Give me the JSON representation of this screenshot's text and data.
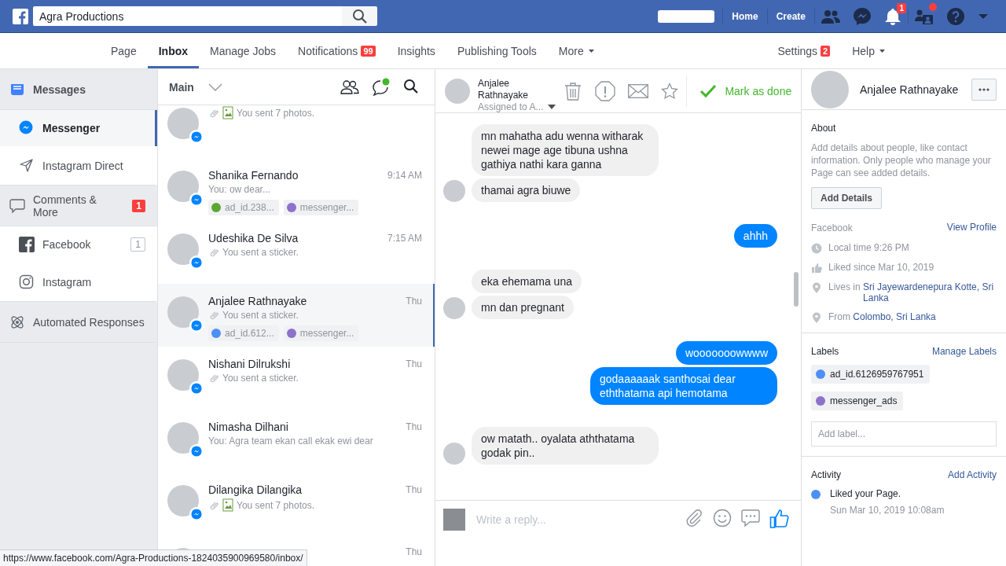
{
  "topbar": {
    "search": {
      "value": "Agra Productions"
    },
    "links": [
      "Home",
      "Create"
    ],
    "notification_badge": "1"
  },
  "tabs": [
    {
      "label": "Page",
      "selected": false,
      "dropdown": false
    },
    {
      "label": "Inbox",
      "selected": true,
      "dropdown": false
    },
    {
      "label": "Manage Jobs",
      "selected": false,
      "dropdown": false
    },
    {
      "label": "Notifications",
      "selected": false,
      "dropdown": false,
      "badge": "99"
    },
    {
      "label": "Insights",
      "selected": false,
      "dropdown": false
    },
    {
      "label": "Publishing Tools",
      "selected": false,
      "dropdown": false
    },
    {
      "label": "More",
      "selected": false,
      "dropdown": true
    }
  ],
  "tabs_right": [
    {
      "label": "Settings",
      "dropdown": false,
      "badge": "2"
    },
    {
      "label": "Help",
      "dropdown": true
    }
  ],
  "sidebar": {
    "items": [
      {
        "kind": "section",
        "label": "Messages",
        "selected": false
      },
      {
        "kind": "sub",
        "label": "Messenger",
        "selected": true
      },
      {
        "kind": "sub",
        "label": "Instagram Direct",
        "selected": false
      },
      {
        "kind": "section",
        "label": "Comments & More",
        "selected": false,
        "badge": "1"
      },
      {
        "kind": "sub",
        "label": "Facebook",
        "selected": false,
        "count": "1"
      },
      {
        "kind": "sub",
        "label": "Instagram",
        "selected": false
      },
      {
        "kind": "section",
        "label": "Automated Responses",
        "selected": false
      }
    ]
  },
  "conversation_list": {
    "filter": "Main",
    "conversations": [
      {
        "kind": "photos",
        "preview": "You sent 7 photos.",
        "selected": false
      },
      {
        "kind": "text",
        "name": "Shanika Fernando",
        "time": "9:14 AM",
        "preview": "You: ow dear...",
        "selected": false,
        "labels": [
          {
            "text": "ad_id.238...",
            "color": "#5aa82f"
          },
          {
            "text": "messenger...",
            "color": "#8c72cb"
          }
        ]
      },
      {
        "kind": "sticker",
        "name": "Udeshika De Silva",
        "time": "7:15 AM",
        "preview": "You sent a sticker.",
        "selected": false
      },
      {
        "kind": "sticker",
        "name": "Anjalee Rathnayake",
        "time": "Thu",
        "preview": "You sent a sticker.",
        "selected": true,
        "labels": [
          {
            "text": "ad_id.612...",
            "color": "#4e8ff5"
          },
          {
            "text": "messenger...",
            "color": "#8c72cb"
          }
        ]
      },
      {
        "kind": "sticker",
        "name": "Nishani Dilrukshi",
        "time": "Thu",
        "preview": "You sent a sticker.",
        "selected": false
      },
      {
        "kind": "text",
        "name": "Nimasha Dilhani",
        "time": "Thu",
        "preview": "You: Agra team ekan call ekak ewi dear",
        "selected": false
      },
      {
        "kind": "photos",
        "name": "Dilangika Dilangika",
        "time": "Thu",
        "preview": "You sent 7 photos.",
        "selected": false
      },
      {
        "time": "Thu",
        "selected": false
      }
    ]
  },
  "chat": {
    "name": "Anjalee Rathnayake",
    "assigned": "Assigned to A...",
    "done": "Mark as done",
    "groups": [
      {
        "kind": "received",
        "bubbles": [
          "mn mahatha adu wenna witharak newei mage age tibuna ushna gathiya nathi kara ganna",
          "thamai agra biuwe"
        ]
      },
      {
        "kind": "sent",
        "bubbles": [
          "ahhh"
        ]
      },
      {
        "kind": "received",
        "bubbles": [
          "eka ehemama una",
          "mn dan pregnant"
        ]
      },
      {
        "kind": "sent",
        "bubbles": [
          "wooooooowwww",
          "godaaaaaak santhosai dear eththatama api hemotama"
        ]
      },
      {
        "kind": "received",
        "bubbles": [
          "ow matath.. oyalata aththatama godak pin.."
        ]
      }
    ],
    "composer": {
      "placeholder": "Write a reply..."
    }
  },
  "details": {
    "name": "Anjalee Rathnayake",
    "about": {
      "title": "About",
      "text": "Add details about people, like contact information. Only people who manage your Page can see added details.",
      "button": "Add Details"
    },
    "facebook": {
      "title": "Facebook",
      "link": "View Profile",
      "rows": [
        {
          "text": "Local time 9:26 PM"
        },
        {
          "text": "Liked since Mar 10, 2019"
        },
        {
          "text": "Lives in ",
          "link": "Sri Jayewardenepura Kotte, Sri Lanka"
        },
        {
          "text": "From ",
          "link": "Colombo, Sri Lanka"
        }
      ]
    },
    "labels": {
      "title": "Labels",
      "link": "Manage Labels",
      "chips": [
        {
          "text": "ad_id.6126959767951",
          "color": "#4e8ff5"
        },
        {
          "text": "messenger_ads",
          "color": "#8c72cb"
        }
      ],
      "placeholder": "Add label..."
    },
    "activity": {
      "title": "Activity",
      "link": "Add Activity",
      "items": [
        {
          "text": "Liked your Page.",
          "time": "Sun Mar 10, 2019 10:08am"
        }
      ]
    }
  },
  "status_url": "https://www.facebook.com/Agra-Productions-1824035900969580/inbox/"
}
